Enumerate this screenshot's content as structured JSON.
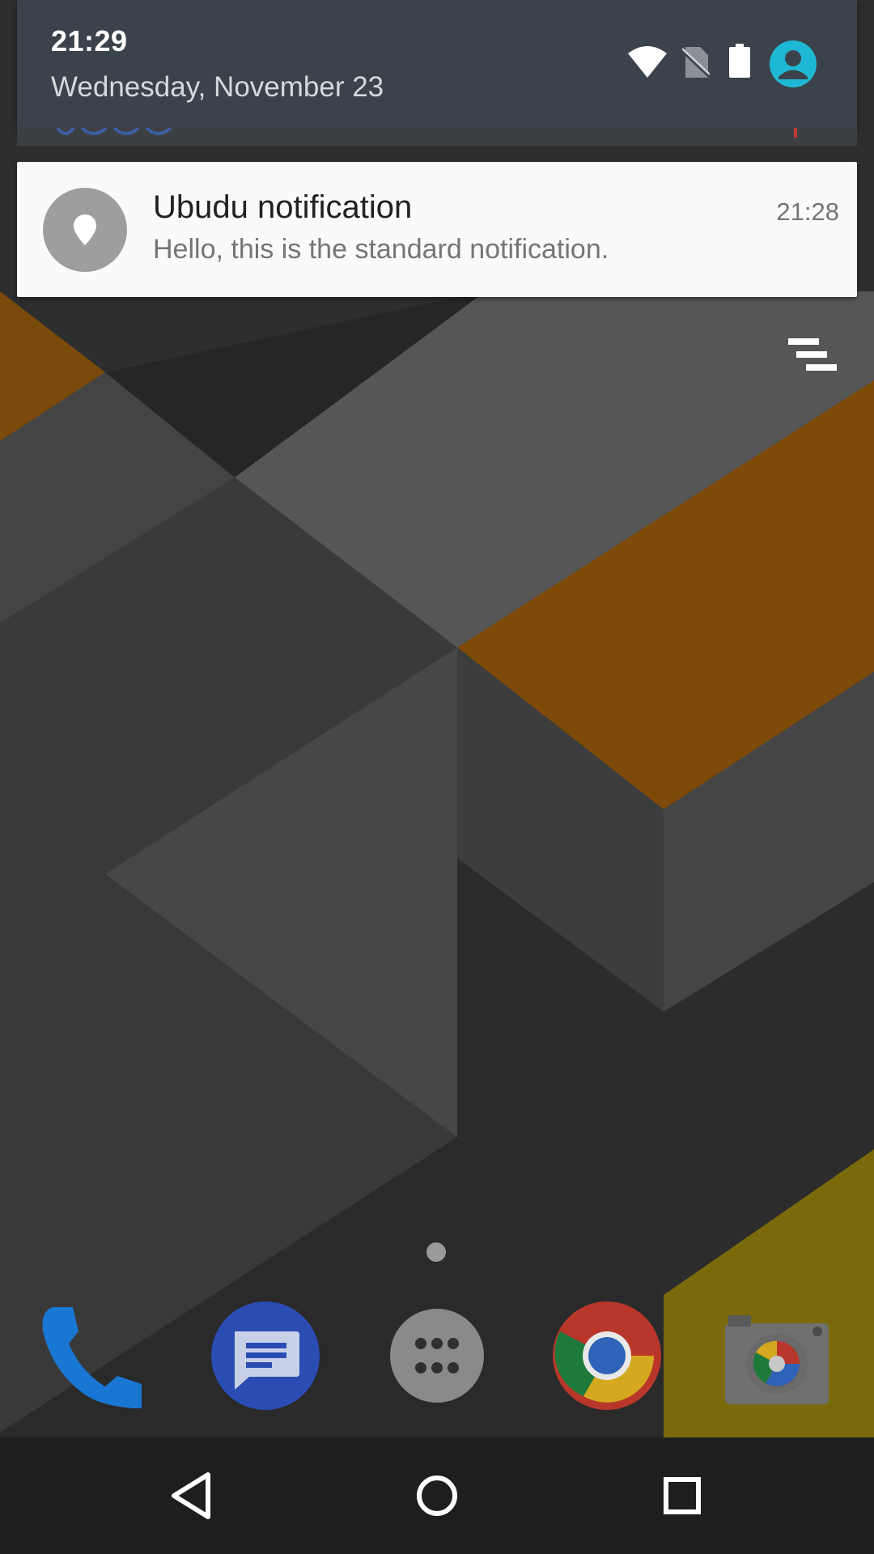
{
  "status_header": {
    "time": "21:29",
    "date": "Wednesday, November 23",
    "icons": [
      "wifi-icon",
      "no-sim-icon",
      "battery-icon",
      "user-icon"
    ],
    "accent_color": "#1fb8d4"
  },
  "notification": {
    "app_icon": "location-pin-icon",
    "title": "Ubudu notification",
    "text": "Hello, this is the standard notification.",
    "time": "21:28"
  },
  "clear_all": {
    "icon": "clear-all-icon"
  },
  "dock": {
    "apps": [
      {
        "name": "phone",
        "icon": "phone-icon"
      },
      {
        "name": "messages",
        "icon": "messages-icon"
      },
      {
        "name": "app drawer",
        "icon": "apps-grid-icon"
      },
      {
        "name": "chrome",
        "icon": "chrome-icon"
      },
      {
        "name": "camera",
        "icon": "camera-icon"
      }
    ]
  },
  "navigation": {
    "buttons": [
      "back-icon",
      "home-icon",
      "recents-icon"
    ]
  }
}
